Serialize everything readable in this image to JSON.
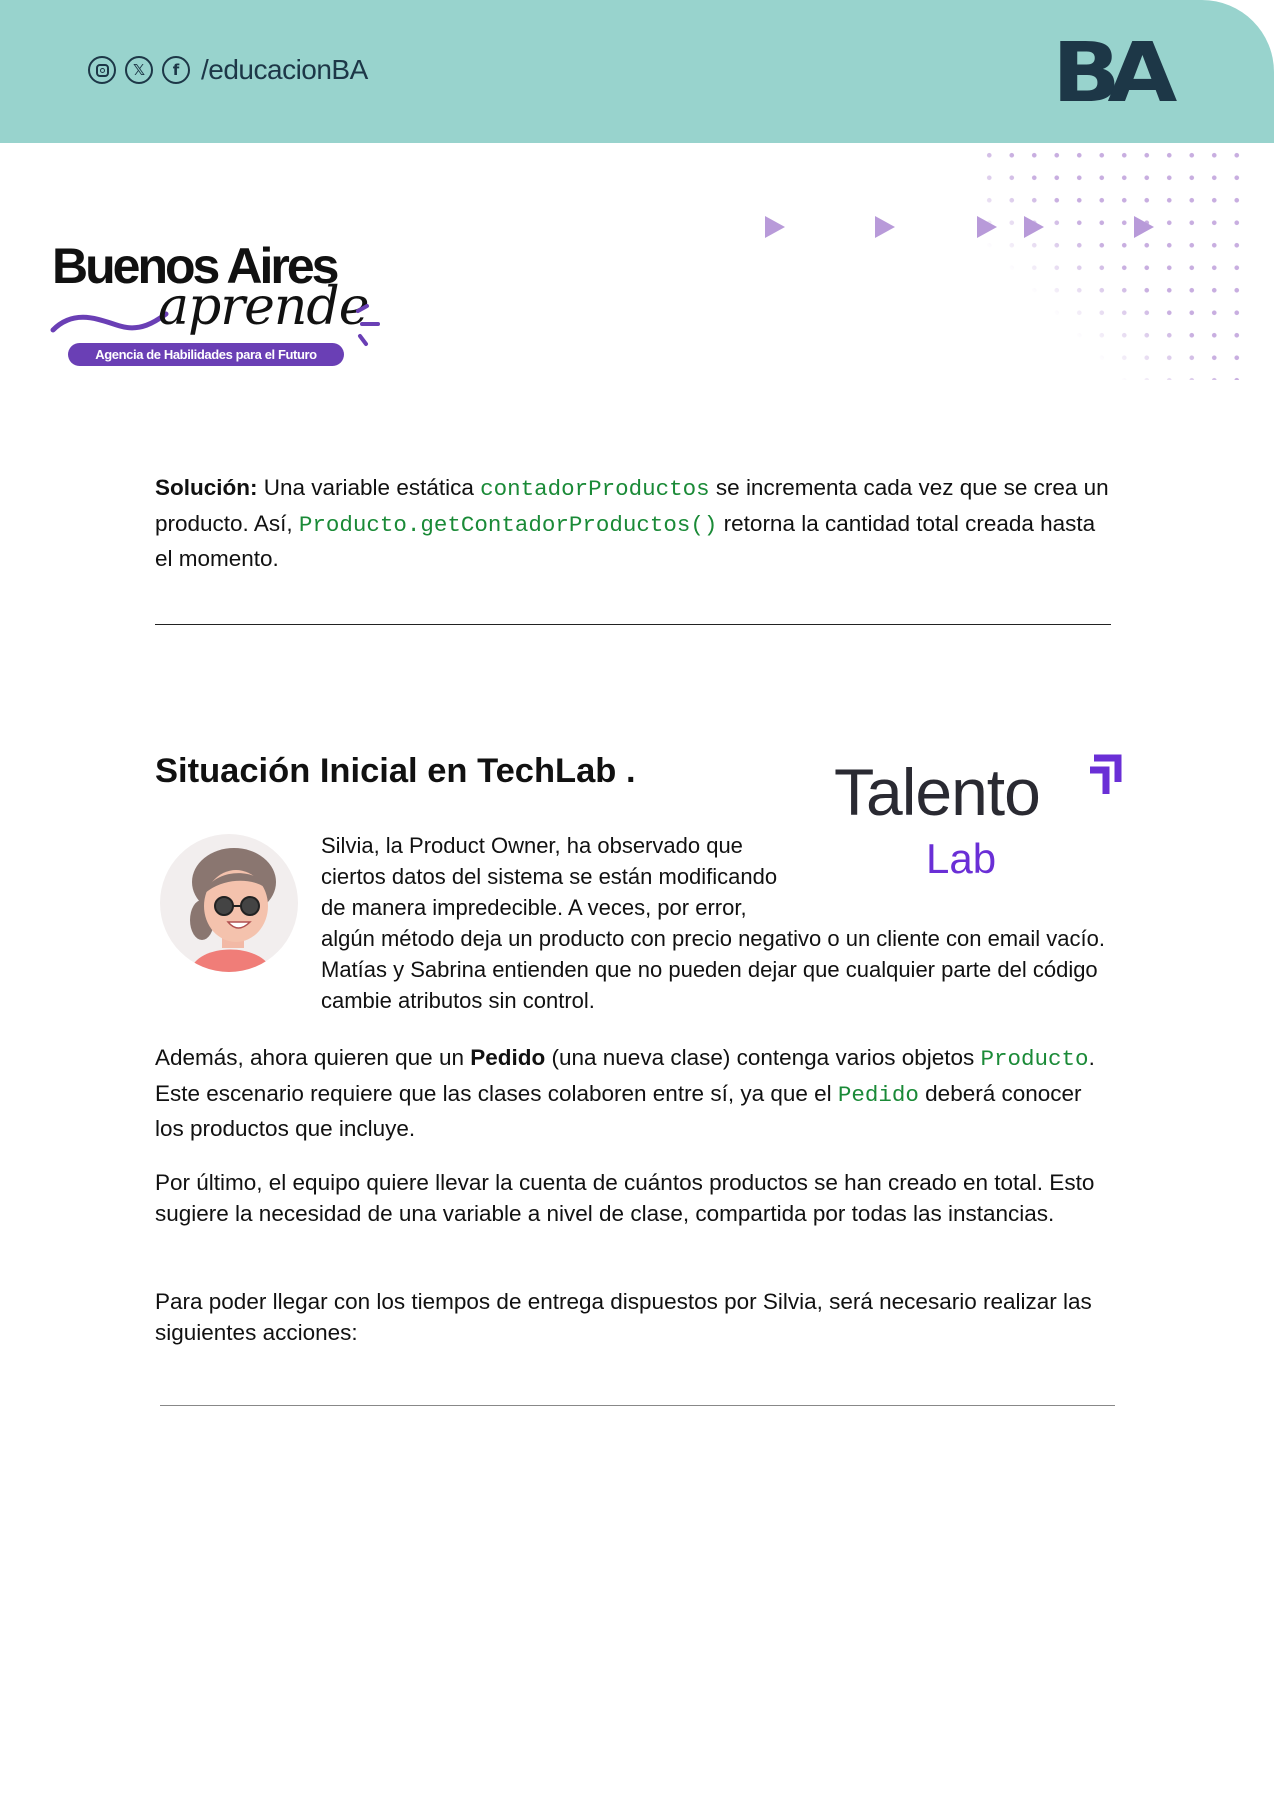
{
  "header": {
    "social_icons": [
      "instagram-icon",
      "x-icon",
      "facebook-icon"
    ],
    "x_glyph": "𝕏",
    "facebook_glyph": "f",
    "handle": "/educacionBA",
    "brand_logo": "BA",
    "colors": {
      "band": "#98d3cd",
      "ink": "#1d3747"
    }
  },
  "brand": {
    "title": "Buenos Aires",
    "script": "aprende",
    "tagline": "Agencia de Habilidades para el Futuro",
    "accent": "#6a3fb5"
  },
  "solution": {
    "label": "Solución:",
    "text1": " Una variable estática ",
    "code1": "contadorProductos",
    "text2": " se incrementa cada vez que se crea un producto. Así, ",
    "code2": "Producto.getContadorProductos()",
    "text3": " retorna la cantidad total creada hasta el momento."
  },
  "section": {
    "title": "Situación Inicial en TechLab .",
    "logo": {
      "word1": "Talento",
      "word2": "Lab",
      "accent": "#6a2fd6"
    },
    "intro": "Silvia, la Product Owner, ha observado que ciertos datos del sistema se están modificando de manera impredecible. A veces, por error, algún método deja un producto con precio negativo o un cliente con email vacío. Matías y Sabrina entienden que no pueden dejar que cualquier parte del código cambie atributos sin control.",
    "p2": {
      "t1": "Además, ahora quieren que un ",
      "bold": "Pedido",
      "t2": " (una nueva clase) contenga varios objetos ",
      "code1": "Producto",
      "t3": ". Este escenario requiere que las clases colaboren entre sí, ya que el ",
      "code2": "Pedido",
      "t4": " deberá conocer los productos que incluye."
    },
    "p3": "Por último, el equipo quiere llevar la cuenta de cuántos productos se han creado en total. Esto sugiere la necesidad de una variable a nivel de clase, compartida por todas las instancias.",
    "p4": "Para poder llegar con los tiempos de entrega dispuestos por Silvia, será necesario realizar las siguientes acciones:"
  }
}
